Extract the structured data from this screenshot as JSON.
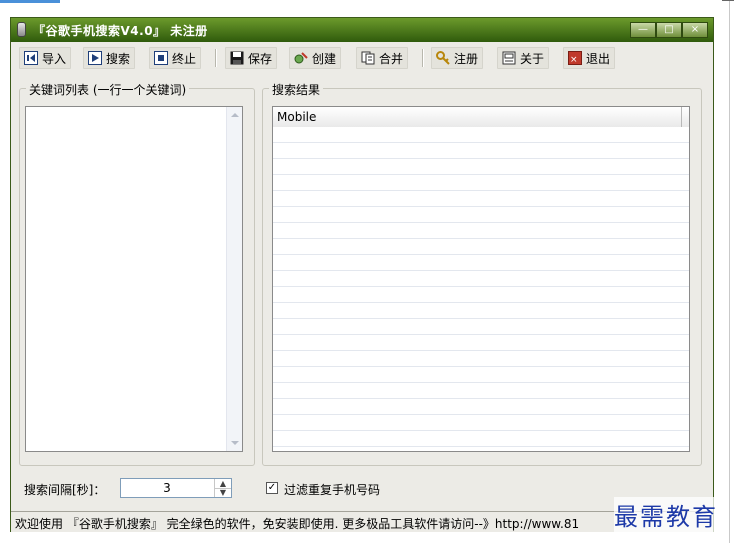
{
  "window": {
    "title": "『谷歌手机搜索V4.0』 未注册",
    "controls": [
      "—",
      "□",
      "×"
    ]
  },
  "toolbar": {
    "buttons": [
      {
        "label": "导入",
        "icon": "import-icon"
      },
      {
        "label": "搜索",
        "icon": "search-play-icon"
      },
      {
        "label": "终止",
        "icon": "stop-icon"
      },
      {
        "label": "保存",
        "icon": "save-disk-icon"
      },
      {
        "label": "创建",
        "icon": "create-icon"
      },
      {
        "label": "合并",
        "icon": "merge-icon"
      },
      {
        "label": "注册",
        "icon": "key-icon"
      },
      {
        "label": "关于",
        "icon": "about-icon"
      },
      {
        "label": "退出",
        "icon": "exit-icon"
      }
    ]
  },
  "keywords": {
    "group_title": "关键词列表 (一行一个关键词)",
    "value": ""
  },
  "results": {
    "group_title": "搜索结果",
    "columns": [
      "Mobile"
    ],
    "rows": []
  },
  "settings": {
    "interval_label": "搜索间隔[秒]：",
    "interval_value": "3",
    "filter_label": "过滤重复手机号码",
    "filter_checked": true
  },
  "status": {
    "text": "欢迎使用 『谷歌手机搜索』 完全绿色的软件，免安装即使用. 更多极品工具软件请访问--》http://www.81"
  },
  "watermark": {
    "text": "最需教育"
  },
  "colors": {
    "titlebar": "#3f6b14",
    "window_bg": "#ecebe6",
    "watermark": "#1e3aa8"
  }
}
